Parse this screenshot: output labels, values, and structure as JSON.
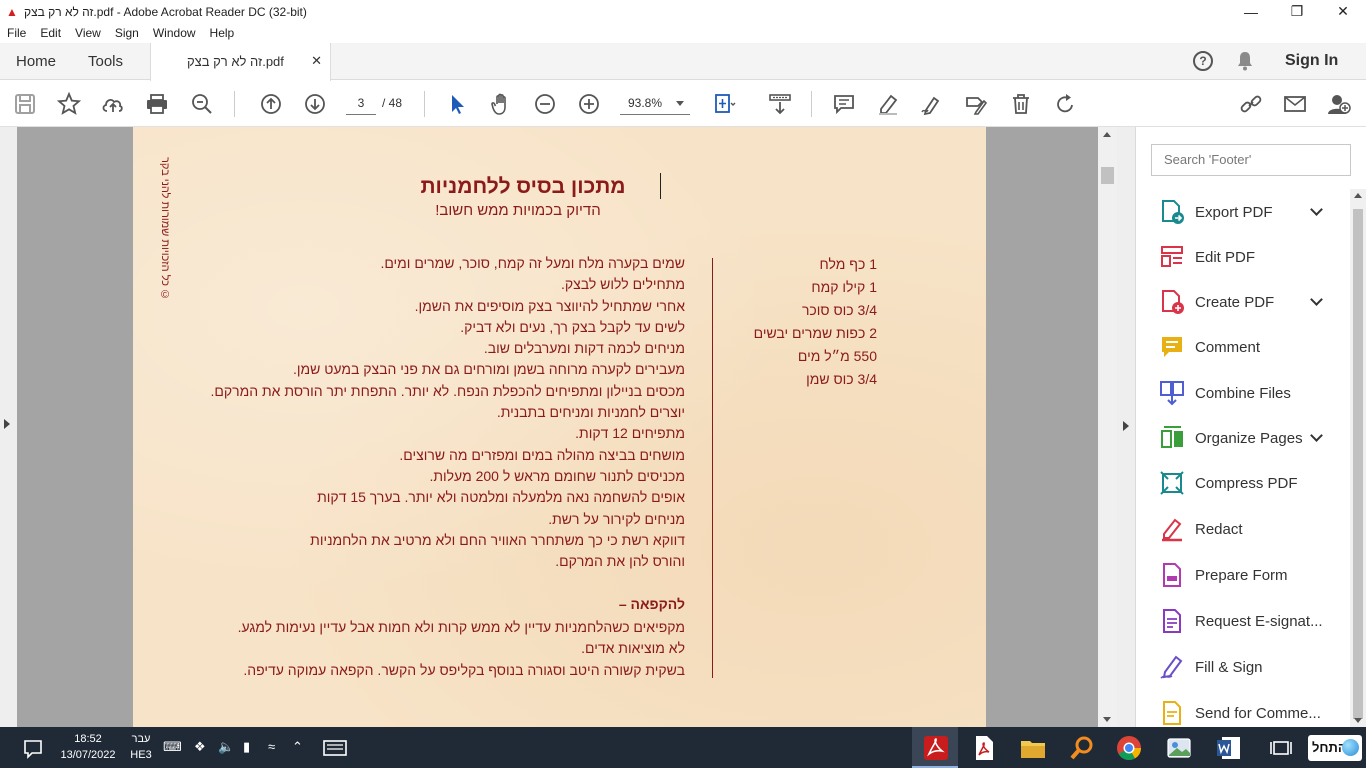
{
  "window": {
    "title": "זה לא רק בצק.pdf - Adobe Acrobat Reader DC (32-bit)"
  },
  "menu": [
    "File",
    "Edit",
    "View",
    "Sign",
    "Window",
    "Help"
  ],
  "tabs": {
    "home": "Home",
    "tools": "Tools",
    "document": "זה לא רק בצק.pdf"
  },
  "header": {
    "sign_in": "Sign In"
  },
  "toolbar": {
    "current_page": "3",
    "total_pages": "/ 48",
    "zoom": "93.8%"
  },
  "page": {
    "side_text": "כל הזכויות שמורות להני בקר ©",
    "title": "מתכון בסיס ללחמניות",
    "subtitle": "הדיוק בכמויות ממש חשוב!",
    "ingredients": [
      "1 כף מלח",
      "1 קילו קמח",
      "3/4 כוס סוכר",
      "2 כפות שמרים יבשים",
      "550 מ״ל מים",
      "3/4 כוס שמן"
    ],
    "steps": [
      "שמים בקערה מלח ומעל זה קמח, סוכר, שמרים ומים.",
      "מתחילים ללוש לבצק.",
      "אחרי שמתחיל להיווצר בצק מוסיפים את השמן.",
      "לשים עד לקבל בצק רך, נעים ולא דביק.",
      "מניחים לכמה דקות ומערבלים שוב.",
      "מעבירים לקערה מרוחה בשמן ומורחים גם את פני הבצק במעט שמן.",
      "מכסים בניילון ומתפיחים להכפלת הנפח. לא יותר. התפחת יתר הורסת את המרקם.",
      "יוצרים לחמניות ומניחים בתבנית.",
      "מתפיחים 12 דקות.",
      "מושחים בביצה מהולה במים ומפזרים מה שרוצים.",
      "מכניסים לתנור שחומם מראש ל 200 מעלות.",
      "אופים להשחמה נאה מלמעלה ומלמטה ולא יותר. בערך 15 דקות",
      "מניחים לקירור על רשת.",
      "דווקא רשת כי כך משתחרר האוויר החם ולא מרטיב את הלחמניות",
      "והורס להן את המרקם."
    ],
    "freeze_title": "להקפאה –",
    "freeze_steps": [
      "מקפיאים כשהלחמניות עדיין לא ממש קרות ולא חמות אבל עדיין נעימות למגע.",
      "לא מוציאות אדים.",
      "בשקית קשורה היטב וסגורה בנוסף בקליפס על הקשר. הקפאה עמוקה עדיפה."
    ]
  },
  "right_panel": {
    "search_placeholder": "Search 'Footer'",
    "tools": [
      {
        "label": "Export PDF",
        "icon": "export-pdf-icon",
        "color": "#1b8a8f"
      },
      {
        "label": "Edit PDF",
        "icon": "edit-pdf-icon",
        "color": "#d9354a"
      },
      {
        "label": "Create PDF",
        "icon": "create-pdf-icon",
        "color": "#d9354a"
      },
      {
        "label": "Comment",
        "icon": "comment-icon",
        "color": "#e8b012"
      },
      {
        "label": "Combine Files",
        "icon": "combine-files-icon",
        "color": "#4f5fd2"
      },
      {
        "label": "Organize Pages",
        "icon": "organize-pages-icon",
        "color": "#3a9e3a"
      },
      {
        "label": "Compress PDF",
        "icon": "compress-pdf-icon",
        "color": "#1b8a8f"
      },
      {
        "label": "Redact",
        "icon": "redact-icon",
        "color": "#d9354a"
      },
      {
        "label": "Prepare Form",
        "icon": "prepare-form-icon",
        "color": "#b23ab0"
      },
      {
        "label": "Request E-signat...",
        "icon": "request-esign-icon",
        "color": "#8a3ac0"
      },
      {
        "label": "Fill & Sign",
        "icon": "fill-sign-icon",
        "color": "#6a4fc8"
      },
      {
        "label": "Send for Comme...",
        "icon": "send-comment-icon",
        "color": "#e8b012"
      }
    ]
  },
  "taskbar": {
    "time": "18:52",
    "date": "13/07/2022",
    "lang_top": "עבר",
    "lang_bottom": "HE3",
    "start": "התחל"
  }
}
